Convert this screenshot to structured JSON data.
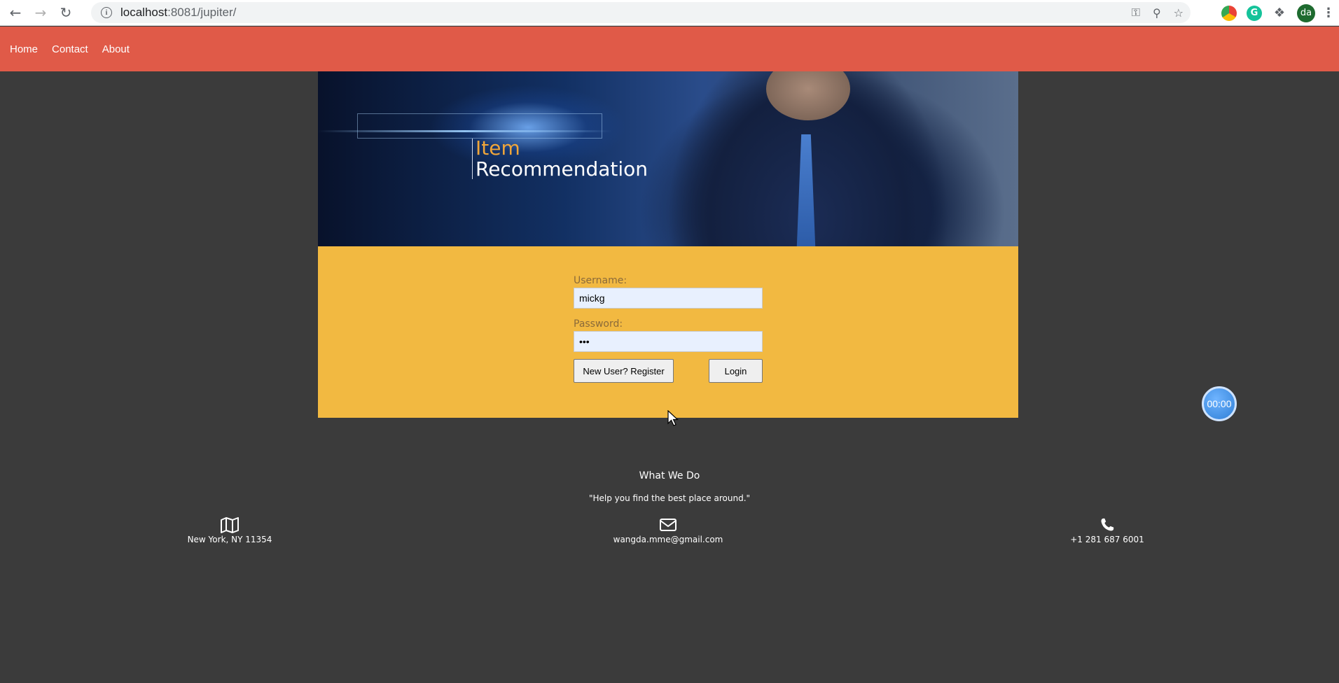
{
  "browser": {
    "url_host": "localhost",
    "url_path": ":8081/jupiter/",
    "profile_initials": "da"
  },
  "nav": {
    "items": [
      {
        "label": "Home"
      },
      {
        "label": "Contact"
      },
      {
        "label": "About"
      }
    ]
  },
  "hero": {
    "title_line1": "Item",
    "title_line2": "Recommendation",
    "accent_color": "#f0a63a"
  },
  "login": {
    "username_label": "Username:",
    "username_value": "mickg",
    "password_label": "Password:",
    "password_value": "•••",
    "register_button": "New User? Register",
    "login_button": "Login",
    "panel_color": "#f2b941"
  },
  "timer": {
    "value": "00:00"
  },
  "footer": {
    "title": "What We Do",
    "quote": "\"Help you find the best place around.\"",
    "address": "New York, NY 11354",
    "email": "wangda.mme@gmail.com",
    "phone": "+1 281 687 6001"
  },
  "colors": {
    "nav_bar": "#e05a48",
    "background": "#3b3b3b"
  }
}
